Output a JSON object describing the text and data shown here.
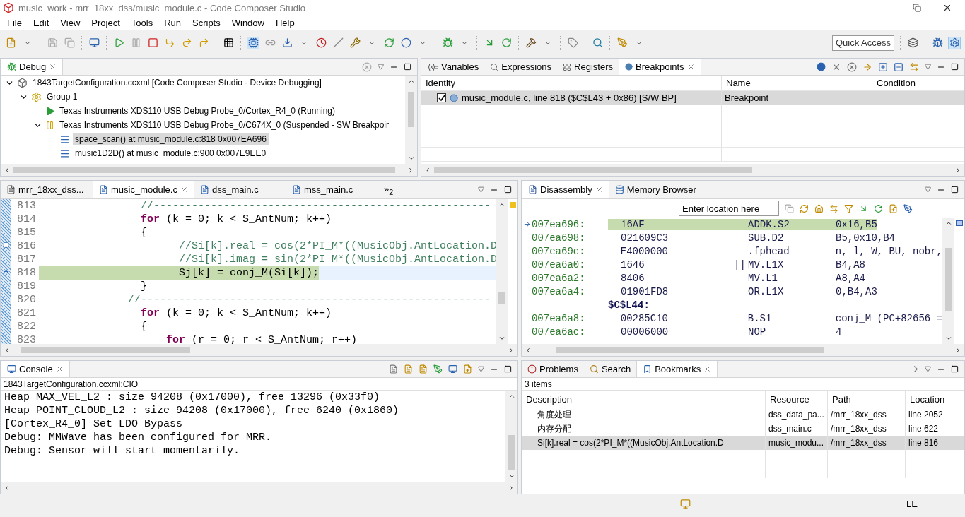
{
  "window": {
    "title": "music_work - mrr_18xx_dss/music_module.c - Code Composer Studio"
  },
  "menu": [
    "File",
    "Edit",
    "View",
    "Project",
    "Tools",
    "Run",
    "Scripts",
    "Window",
    "Help"
  ],
  "quick_access": "Quick Access",
  "debug_view": {
    "tab": "Debug",
    "tree": [
      {
        "label": "1843TargetConfiguration.ccxml [Code Composer Studio - Device Debugging]",
        "kind": "config",
        "expanded": true,
        "selected": false,
        "children": [
          {
            "label": "Group 1",
            "kind": "group",
            "expanded": true,
            "selected": false,
            "children": [
              {
                "label": "Texas Instruments XDS110 USB Debug Probe_0/Cortex_R4_0 (Running)",
                "kind": "core-running",
                "selected": false
              },
              {
                "label": "Texas Instruments XDS110 USB Debug Probe_0/C674X_0 (Suspended - SW Breakpoir",
                "kind": "core-suspended",
                "expanded": true,
                "selected": false,
                "children": [
                  {
                    "label": "space_scan() at music_module.c:818 0x007EA696",
                    "kind": "frame",
                    "selected": true
                  },
                  {
                    "label": "music1D2D() at music_module.c:900 0x007E9EE0",
                    "kind": "frame",
                    "selected": false
                  }
                ]
              }
            ]
          }
        ]
      }
    ]
  },
  "breakpoints_view": {
    "tabs": [
      {
        "label": "Variables",
        "selected": false
      },
      {
        "label": "Expressions",
        "selected": false
      },
      {
        "label": "Registers",
        "selected": false
      },
      {
        "label": "Breakpoints",
        "selected": true
      }
    ],
    "columns": [
      "Identity",
      "Name",
      "Condition"
    ],
    "rows": [
      {
        "identity": "music_module.c, line 818 ($C$L43 + 0x86)  [S/W BP]",
        "name": "Breakpoint",
        "checked": true,
        "selected": true
      }
    ]
  },
  "editor": {
    "tabs": [
      {
        "label": "mrr_18xx_dss...",
        "kind": "text",
        "selected": false
      },
      {
        "label": "music_module.c",
        "kind": "c",
        "selected": true
      },
      {
        "label": "dss_main.c",
        "kind": "c",
        "selected": false
      },
      {
        "label": "mss_main.c",
        "kind": "c",
        "selected": false
      }
    ],
    "overflow": "»$_{2}$",
    "lines": [
      {
        "number": "813",
        "bookmark": false,
        "current": false,
        "segments": [
          {
            "kind": "comment",
            "text": "                //-----------------------------------------------------"
          }
        ]
      },
      {
        "number": "814",
        "bookmark": false,
        "current": false,
        "segments": [
          {
            "kind": "keyword",
            "text": "                for"
          },
          {
            "kind": "plain",
            "text": " (k = 0; k < S_AntNum; k++)"
          }
        ]
      },
      {
        "number": "815",
        "bookmark": false,
        "current": false,
        "segments": [
          {
            "kind": "plain",
            "text": "                {"
          }
        ]
      },
      {
        "number": "816",
        "bookmark": true,
        "current": false,
        "segments": [
          {
            "kind": "comment",
            "text": "                      //Si[k].real = cos(2*PI_M*((MusicObj.AntLocation.D"
          }
        ]
      },
      {
        "number": "817",
        "bookmark": false,
        "current": false,
        "segments": [
          {
            "kind": "comment",
            "text": "                      //Si[k].imag = sin(2*PI_M*((MusicObj.AntLocation.D"
          }
        ]
      },
      {
        "number": "818",
        "bookmark": false,
        "current": true,
        "segments": [
          {
            "kind": "plain",
            "text": "                      Sj[k] = conj_M(Si[k]);"
          }
        ]
      },
      {
        "number": "819",
        "bookmark": false,
        "current": false,
        "segments": [
          {
            "kind": "plain",
            "text": "                }"
          }
        ]
      },
      {
        "number": "820",
        "bookmark": false,
        "current": false,
        "segments": [
          {
            "kind": "comment",
            "text": "              //-------------------------------------------------------"
          }
        ]
      },
      {
        "number": "821",
        "bookmark": false,
        "current": false,
        "segments": [
          {
            "kind": "keyword",
            "text": "                for"
          },
          {
            "kind": "plain",
            "text": " (k = 0; k < S_AntNum; k++)"
          }
        ]
      },
      {
        "number": "822",
        "bookmark": false,
        "current": false,
        "segments": [
          {
            "kind": "plain",
            "text": "                {"
          }
        ]
      },
      {
        "number": "823",
        "bookmark": false,
        "current": false,
        "segments": [
          {
            "kind": "keyword",
            "text": "                    for"
          },
          {
            "kind": "plain",
            "text": " (r = 0; r < S_AntNum; r++)"
          }
        ]
      }
    ]
  },
  "disassembly": {
    "tabs": [
      {
        "label": "Disassembly",
        "selected": true
      },
      {
        "label": "Memory Browser",
        "selected": false
      }
    ],
    "location_placeholder": "Enter location here",
    "rows": [
      {
        "kind": "instr",
        "address": "007ea696:",
        "opcode": "16AF",
        "mnemonic": "ADDK.S2",
        "operands": "0x16,B5",
        "current": true
      },
      {
        "kind": "instr",
        "address": "007ea698:",
        "opcode": "021609C3",
        "mnemonic": "SUB.D2",
        "operands": "B5,0x10,B4",
        "current": false
      },
      {
        "kind": "instr",
        "address": "007ea69c:",
        "opcode": "E4000000",
        "mnemonic": ".fphead",
        "operands": "n, l, W, BU, nobr,",
        "current": false
      },
      {
        "kind": "instr",
        "address": "007ea6a0:",
        "opcode": "1646",
        "parallel": "||",
        "mnemonic": "MV.L1X",
        "operands": "B4,A8",
        "current": false
      },
      {
        "kind": "instr",
        "address": "007ea6a2:",
        "opcode": "8406",
        "mnemonic": "MV.L1",
        "operands": "A8,A4",
        "current": false
      },
      {
        "kind": "instr",
        "address": "007ea6a4:",
        "opcode": "01901FD8",
        "mnemonic": "OR.L1X",
        "operands": "0,B4,A3",
        "current": false
      },
      {
        "kind": "label",
        "text": "$C$L44:"
      },
      {
        "kind": "instr",
        "address": "007ea6a8:",
        "opcode": "00285C10",
        "mnemonic": "B.S1",
        "operands": "conj_M (PC+82656 =",
        "current": false
      },
      {
        "kind": "instr",
        "address": "007ea6ac:",
        "opcode": "00006000",
        "mnemonic": "NOP",
        "operands": "4",
        "current": false
      }
    ]
  },
  "console": {
    "tab": "Console",
    "subtitle": "1843TargetConfiguration.ccxml:CIO",
    "lines": [
      "Heap MAX_VEL_L2 : size 94208 (0x17000), free 13296 (0x33f0)",
      "Heap POINT_CLOUD_L2 : size 94208 (0x17000), free 6240 (0x1860)",
      "[Cortex_R4_0] Set LDO Bypass",
      "Debug: MMWave has been configured for MRR.",
      "Debug: Sensor will start momentarily."
    ]
  },
  "bookmarks_view": {
    "tabs": [
      {
        "label": "Problems",
        "selected": false
      },
      {
        "label": "Search",
        "selected": false
      },
      {
        "label": "Bookmarks",
        "selected": true
      }
    ],
    "count": "3 items",
    "columns": [
      "Description",
      "Resource",
      "Path",
      "Location"
    ],
    "rows": [
      {
        "description": "角度处理",
        "resource": "dss_data_pa...",
        "path": "/mrr_18xx_dss",
        "location": "line 2052",
        "selected": false
      },
      {
        "description": "内存分配",
        "resource": "dss_main.c",
        "path": "/mrr_18xx_dss",
        "location": "line 622",
        "selected": false
      },
      {
        "description": "Si[k].real = cos(2*PI_M*((MusicObj.AntLocation.D",
        "resource": "music_modu...",
        "path": "/mrr_18xx_dss",
        "location": "line 816",
        "selected": true
      }
    ]
  },
  "status_bar": {
    "endianness": "LE"
  }
}
